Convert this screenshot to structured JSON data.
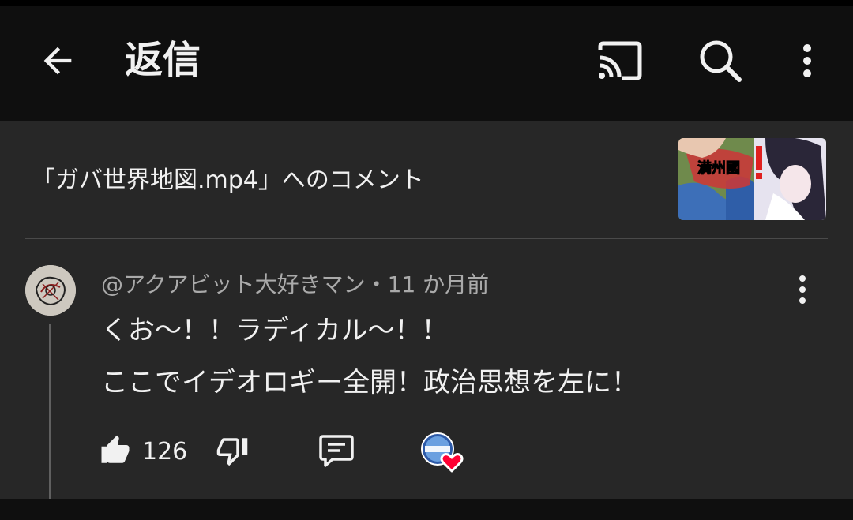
{
  "appbar": {
    "title": "返信",
    "icons": {
      "back": "arrow-back-icon",
      "cast": "cast-icon",
      "search": "search-icon",
      "more": "more-vert-icon"
    }
  },
  "video": {
    "header_text": "「ガバ世界地図.mp4」へのコメント",
    "thumbnail_text": "満州國"
  },
  "comment": {
    "author": "@アクアビット大好きマン",
    "separator": "・",
    "time": "11 か月前",
    "lines": [
      "くお～！！ラディカル～！！",
      "ここでイデオロギー全開！政治思想を左に！"
    ],
    "like_count": "126",
    "icons": {
      "like": "thumbs-up-icon",
      "dislike": "thumbs-down-icon",
      "reply": "comment-icon",
      "more": "more-vert-icon",
      "creator_heart": "creator-heart-icon"
    }
  },
  "colors": {
    "background": "#0f0f0f",
    "panel": "#272727",
    "text": "#f1f1f1",
    "meta_text": "#aaaaaa",
    "heart": "#ff0033"
  }
}
